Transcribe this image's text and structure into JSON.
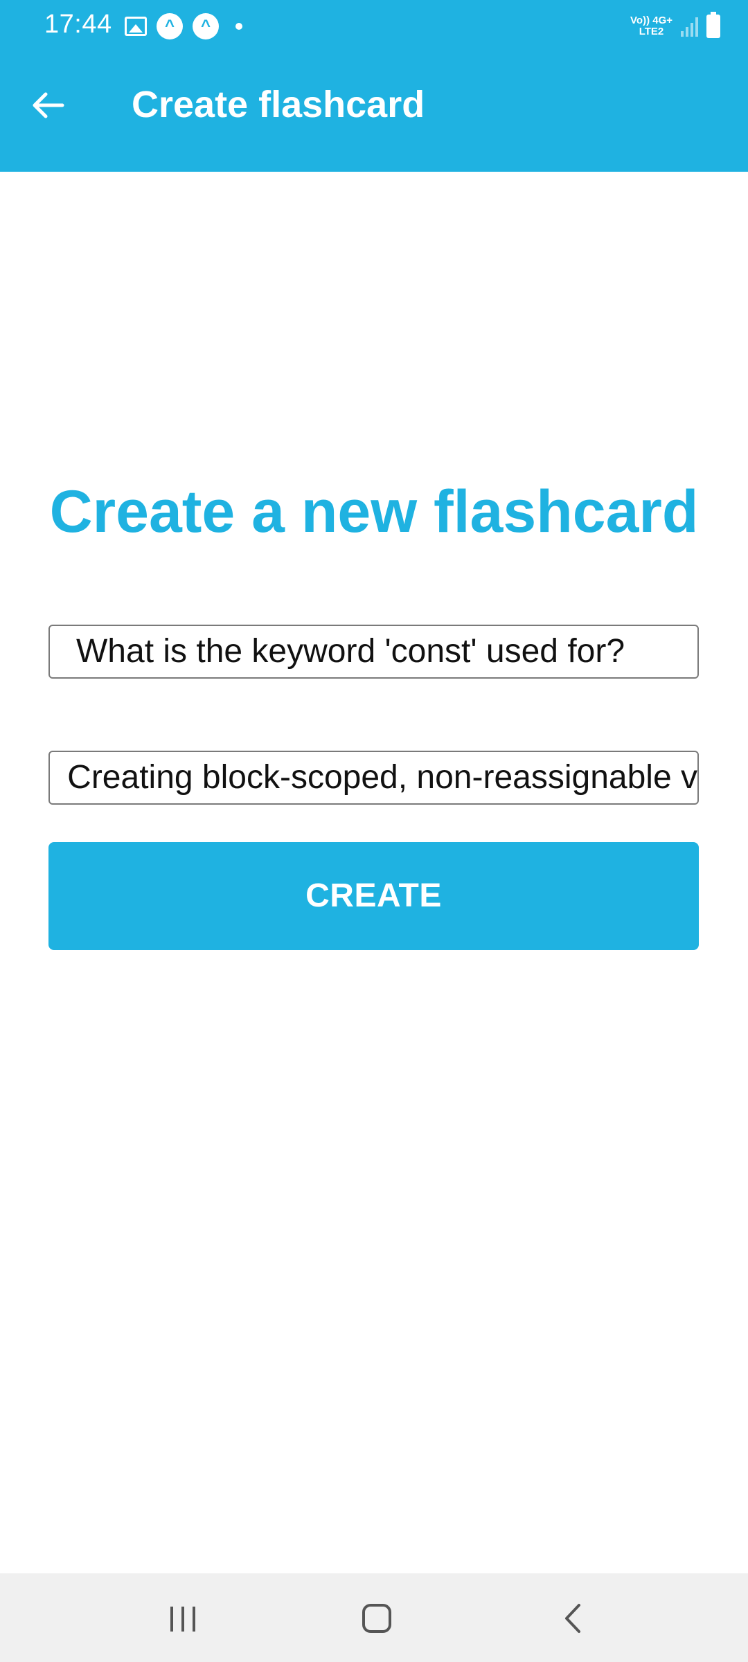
{
  "status_bar": {
    "time": "17:44",
    "network_label_top": "Vo)) 4G+",
    "network_label_bottom": "LTE2",
    "notification_icons": [
      "image-icon",
      "app-notification-icon",
      "app-notification-icon",
      "dot-icon"
    ]
  },
  "app_bar": {
    "title": "Create flashcard",
    "back_icon": "arrow-left-icon"
  },
  "main": {
    "heading": "Create a new flashcard",
    "question_field": {
      "value": "What is the keyword 'const' used for?"
    },
    "answer_field": {
      "value": "Creating block-scoped, non-reassignable v"
    },
    "create_button_label": "CREATE"
  },
  "nav_bar": {
    "icons": [
      "recent-apps-icon",
      "home-icon",
      "back-icon"
    ]
  },
  "colors": {
    "accent": "#1fb2e1",
    "nav_background": "#f0f0f0",
    "field_border": "#7a7a7a"
  }
}
